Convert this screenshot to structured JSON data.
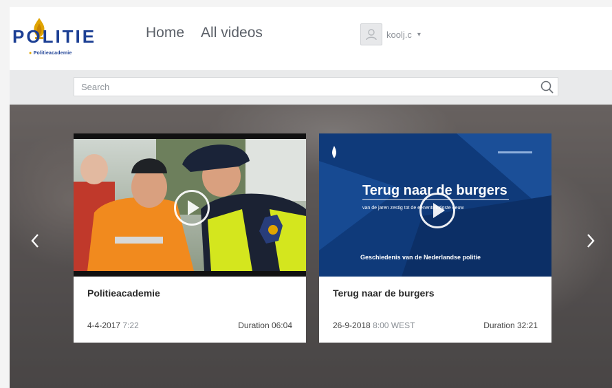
{
  "brand": {
    "logo_text": "POLITIE",
    "logo_subtitle": "Politieacademie"
  },
  "nav": {
    "items": [
      {
        "label": "Home"
      },
      {
        "label": "All videos"
      }
    ]
  },
  "user": {
    "name": "koolj.c"
  },
  "search": {
    "placeholder": "Search"
  },
  "carousel": {
    "cards": [
      {
        "title": "Politieacademie",
        "date": "4-4-2017",
        "time": "7:22",
        "duration": "Duration 06:04"
      },
      {
        "title": "Terug naar de burgers",
        "date": "26-9-2018",
        "time": "8:00 WEST",
        "duration": "Duration 32:21",
        "thumb_headline": "Terug naar de burgers",
        "thumb_tagline": "van de jaren zestig tot de eenentwintigste eeuw",
        "thumb_footer": "Geschiedenis van de Nederlandse politie"
      }
    ]
  },
  "colors": {
    "brand_blue": "#1c3f94",
    "brand_gold": "#e0a400",
    "thumb_blue": "#0f3a7a"
  }
}
